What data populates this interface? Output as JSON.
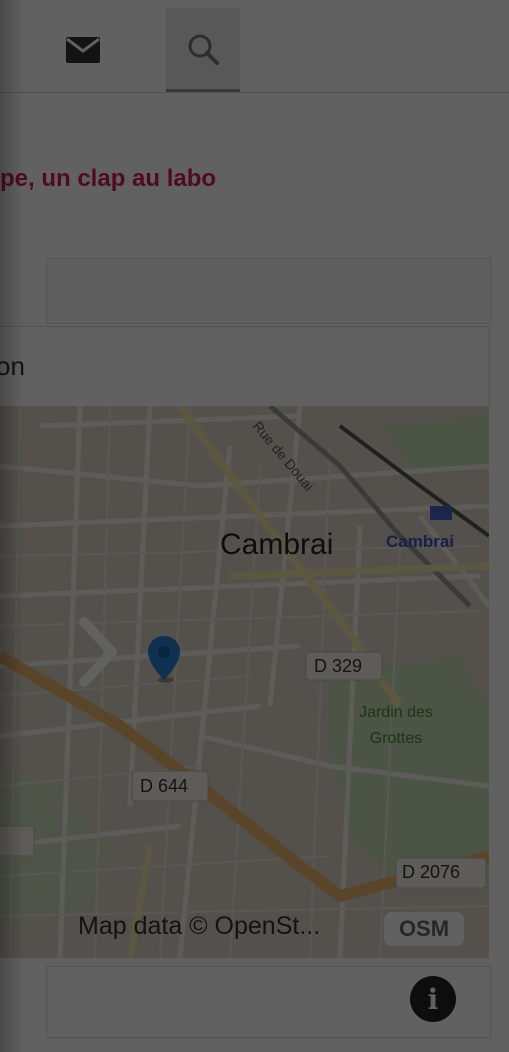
{
  "header": {
    "tabs": [
      {
        "name": "mail",
        "icon": "envelope-icon"
      },
      {
        "name": "search",
        "icon": "search-icon",
        "active": true
      }
    ]
  },
  "article": {
    "headline": "pe, un clap au labo"
  },
  "location": {
    "label": "on"
  },
  "map": {
    "labels": {
      "city": "Cambrai",
      "station": "Cambrai",
      "road_d329": "D 329",
      "road_d644": "D 644",
      "road_d2076": "D 2076",
      "park": "Jardin des Grottes",
      "street": "Rue de Douai"
    },
    "attribution": "Map data © OpenSt...",
    "attribution_badge": "OSM",
    "marker_color": "#2a7fd4"
  },
  "footer": {
    "info_label": "i"
  },
  "colors": {
    "accent": "#d21d5a",
    "overlay": "rgba(0,0,0,0.62)"
  }
}
